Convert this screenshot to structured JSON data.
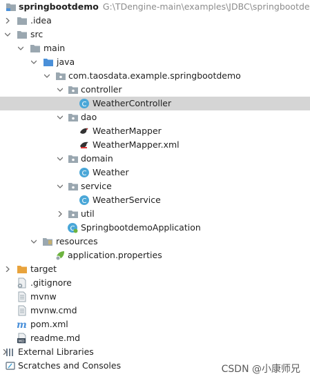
{
  "tree": {
    "root": {
      "name": "springbootdemo",
      "path": "G:\\TDengine-main\\examples\\JDBC\\springbootdemo",
      "icon": "module-folder-icon"
    },
    "idea": ".idea",
    "src": "src",
    "main": "main",
    "java": "java",
    "package": "com.taosdata.example.springbootdemo",
    "controller": "controller",
    "weather_controller": "WeatherController",
    "dao": "dao",
    "weather_mapper": "WeatherMapper",
    "weather_mapper_xml": "WeatherMapper.xml",
    "domain": "domain",
    "weather": "Weather",
    "service": "service",
    "weather_service": "WeatherService",
    "util": "util",
    "app": "SpringbootdemoApplication",
    "resources": "resources",
    "app_props": "application.properties",
    "target": "target",
    "gitignore": ".gitignore",
    "mvnw": "mvnw",
    "mvnw_cmd": "mvnw.cmd",
    "pom": "pom.xml",
    "readme": "readme.md",
    "external_libraries": "External Libraries",
    "scratches": "Scratches and Consoles"
  },
  "selected_item": "WeatherController",
  "watermark": "CSDN @小康师兄",
  "colors": {
    "folder": "#9aa7b0",
    "source_folder": "#4a90d9",
    "target_folder": "#e8a33d",
    "class_circle": "#4aa7d8",
    "selection": "#d5d5d5"
  }
}
